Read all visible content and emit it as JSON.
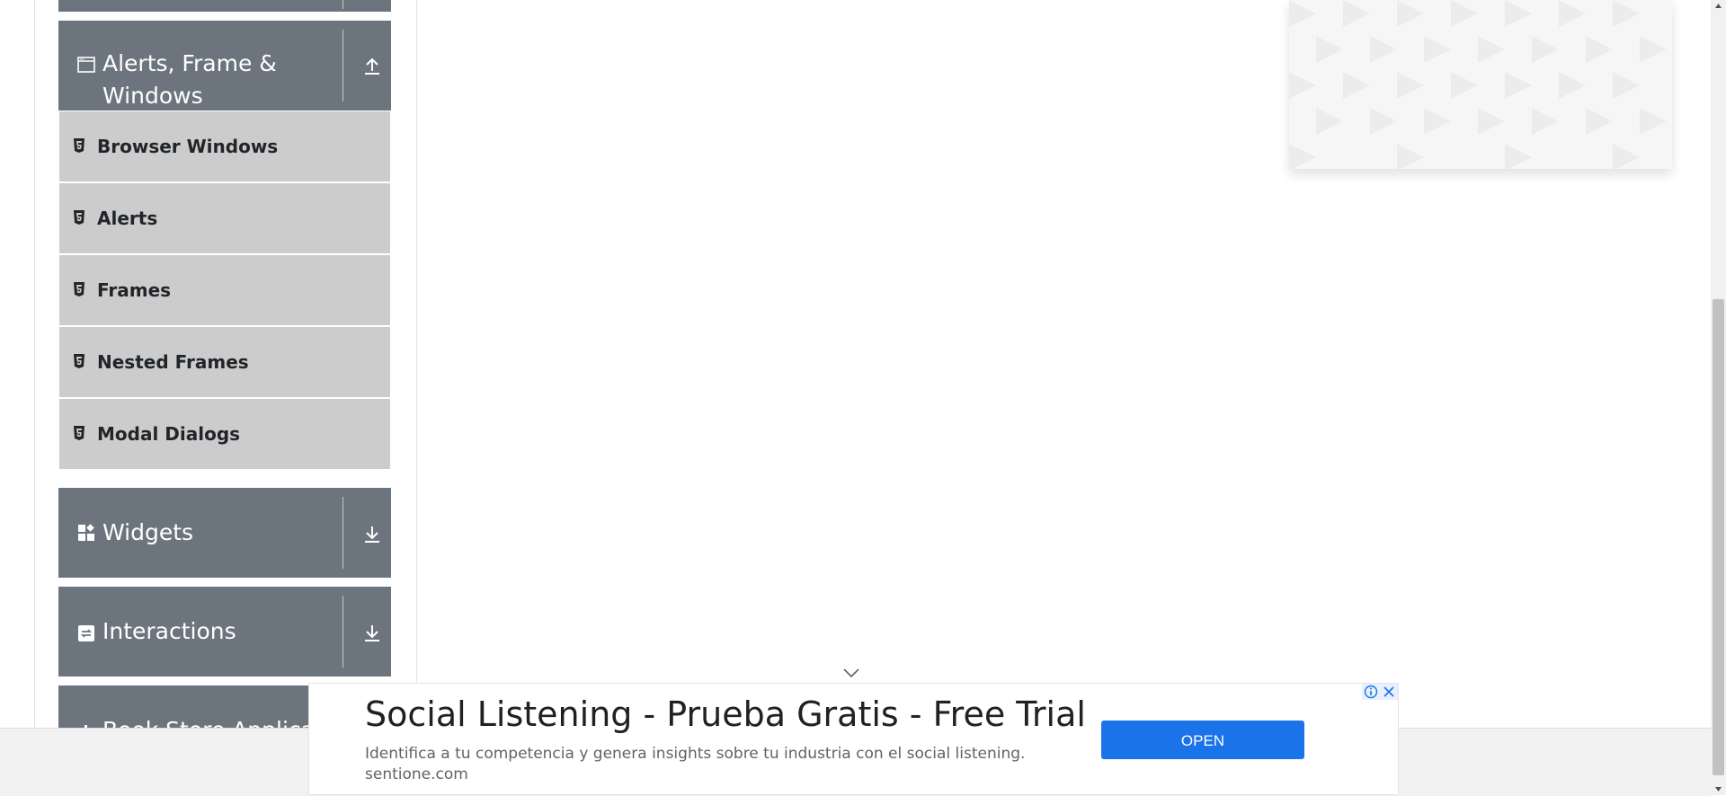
{
  "sidebar": {
    "groups": [
      {
        "title_line1": "Alerts, Frame &",
        "title_line2": "Windows",
        "icon": "window-icon",
        "arrow": "arrow-up-icon"
      },
      {
        "title": "Widgets",
        "icon": "widgets-icon",
        "arrow": "arrow-down-icon"
      },
      {
        "title": "Interactions",
        "icon": "interactions-icon",
        "arrow": "arrow-down-icon"
      },
      {
        "title": "Book Store Applicatio",
        "icon": "book-store-icon"
      }
    ],
    "items": [
      {
        "label": "Browser Windows",
        "icon": "html5-icon"
      },
      {
        "label": "Alerts",
        "icon": "html5-icon"
      },
      {
        "label": "Frames",
        "icon": "html5-icon"
      },
      {
        "label": "Nested Frames",
        "icon": "html5-icon"
      },
      {
        "label": "Modal Dialogs",
        "icon": "html5-icon"
      }
    ]
  },
  "ad_banner": {
    "title": "Social Listening - Prueba Gratis - Free Trial",
    "description": "Identifica a tu competencia y genera insights sobre tu industria con el social listening.",
    "domain": "sentione.com",
    "cta_label": "OPEN"
  },
  "colors": {
    "group_bg": "#6c757d",
    "item_bg": "#cccccc",
    "cta_bg": "#1a73e8"
  }
}
